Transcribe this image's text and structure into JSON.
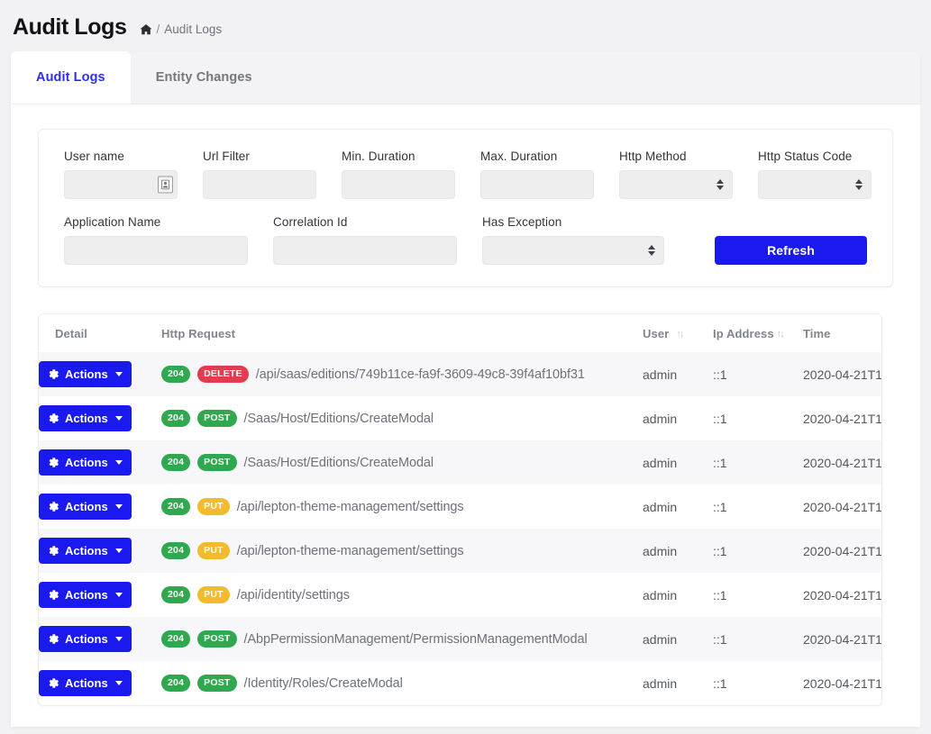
{
  "header": {
    "title": "Audit Logs",
    "breadcrumb": {
      "home_icon": "home-icon",
      "separator": "/",
      "current": "Audit Logs"
    }
  },
  "tabs": [
    {
      "label": "Audit Logs",
      "active": true
    },
    {
      "label": "Entity Changes",
      "active": false
    }
  ],
  "filters": {
    "user_name": {
      "label": "User name",
      "value": "",
      "placeholder": "",
      "picker_icon": "user-card-icon"
    },
    "url_filter": {
      "label": "Url Filter",
      "value": "",
      "placeholder": ""
    },
    "min_duration": {
      "label": "Min. Duration",
      "value": "",
      "placeholder": ""
    },
    "max_duration": {
      "label": "Max. Duration",
      "value": "",
      "placeholder": ""
    },
    "http_method": {
      "label": "Http Method",
      "value": ""
    },
    "http_status_code": {
      "label": "Http Status Code",
      "value": ""
    },
    "application_name": {
      "label": "Application Name",
      "value": "",
      "placeholder": ""
    },
    "correlation_id": {
      "label": "Correlation Id",
      "value": "",
      "placeholder": ""
    },
    "has_exception": {
      "label": "Has Exception",
      "value": ""
    },
    "refresh_label": "Refresh"
  },
  "table": {
    "columns": [
      {
        "key": "detail",
        "label": "Detail",
        "sortable": false
      },
      {
        "key": "http_request",
        "label": "Http Request",
        "sortable": false
      },
      {
        "key": "user",
        "label": "User",
        "sortable": true
      },
      {
        "key": "ip_address",
        "label": "Ip Address",
        "sortable": true
      },
      {
        "key": "time",
        "label": "Time",
        "sortable": false
      }
    ],
    "action_label": "Actions",
    "rows": [
      {
        "status": "204",
        "method": "DELETE",
        "url": "/api/saas/editions/749b11ce-fa9f-3609-49c8-39f4af10bf31",
        "user": "admin",
        "ip": "::1",
        "time": "2020-04-21T1"
      },
      {
        "status": "204",
        "method": "POST",
        "url": "/Saas/Host/Editions/CreateModal",
        "user": "admin",
        "ip": "::1",
        "time": "2020-04-21T1"
      },
      {
        "status": "204",
        "method": "POST",
        "url": "/Saas/Host/Editions/CreateModal",
        "user": "admin",
        "ip": "::1",
        "time": "2020-04-21T1"
      },
      {
        "status": "204",
        "method": "PUT",
        "url": "/api/lepton-theme-management/settings",
        "user": "admin",
        "ip": "::1",
        "time": "2020-04-21T1"
      },
      {
        "status": "204",
        "method": "PUT",
        "url": "/api/lepton-theme-management/settings",
        "user": "admin",
        "ip": "::1",
        "time": "2020-04-21T1"
      },
      {
        "status": "204",
        "method": "PUT",
        "url": "/api/identity/settings",
        "user": "admin",
        "ip": "::1",
        "time": "2020-04-21T1"
      },
      {
        "status": "204",
        "method": "POST",
        "url": "/AbpPermissionManagement/PermissionManagementModal",
        "user": "admin",
        "ip": "::1",
        "time": "2020-04-21T1"
      },
      {
        "status": "204",
        "method": "POST",
        "url": "/Identity/Roles/CreateModal",
        "user": "admin",
        "ip": "::1",
        "time": "2020-04-21T1"
      }
    ]
  },
  "colors": {
    "primary": "#1a1af0",
    "tab_active_text": "#2f2fe8",
    "status_success": "#2fa84f",
    "method_delete": "#e13d4e",
    "method_post": "#2fa84f",
    "method_put": "#f2bb2e",
    "page_background": "#f2f2f5"
  }
}
